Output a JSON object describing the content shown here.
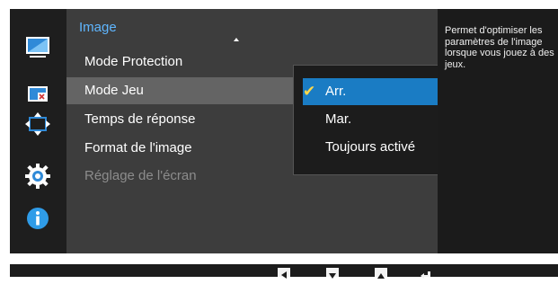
{
  "menu": {
    "title": "Image",
    "items": [
      {
        "label": "Mode Protection",
        "state": "normal"
      },
      {
        "label": "Mode Jeu",
        "state": "selected"
      },
      {
        "label": "Temps de réponse",
        "state": "normal"
      },
      {
        "label": "Format de l'image",
        "state": "normal"
      },
      {
        "label": "Réglage de l'écran",
        "state": "disabled"
      }
    ]
  },
  "submenu": {
    "options": [
      {
        "label": "Arr.",
        "checked": true
      },
      {
        "label": "Mar.",
        "checked": false
      },
      {
        "label": "Toujours activé",
        "checked": false
      }
    ]
  },
  "help": {
    "text": "Permet d'optimiser les paramètres de l'image lorsque vous jouez à des jeux."
  },
  "sidebar": {
    "icons": [
      "monitor-picture-icon",
      "pip-icon",
      "resize-icon",
      "gear-icon",
      "info-icon"
    ],
    "selected": "monitor-picture-icon"
  },
  "bottom_bar": {
    "keys": [
      "left-key-icon",
      "down-key-icon",
      "up-key-icon",
      "enter-key-icon"
    ]
  },
  "colors": {
    "accent": "#5fb6ff",
    "highlight": "#1a7cc4",
    "check": "#ffd84a",
    "panel": "#3d3d3d"
  }
}
